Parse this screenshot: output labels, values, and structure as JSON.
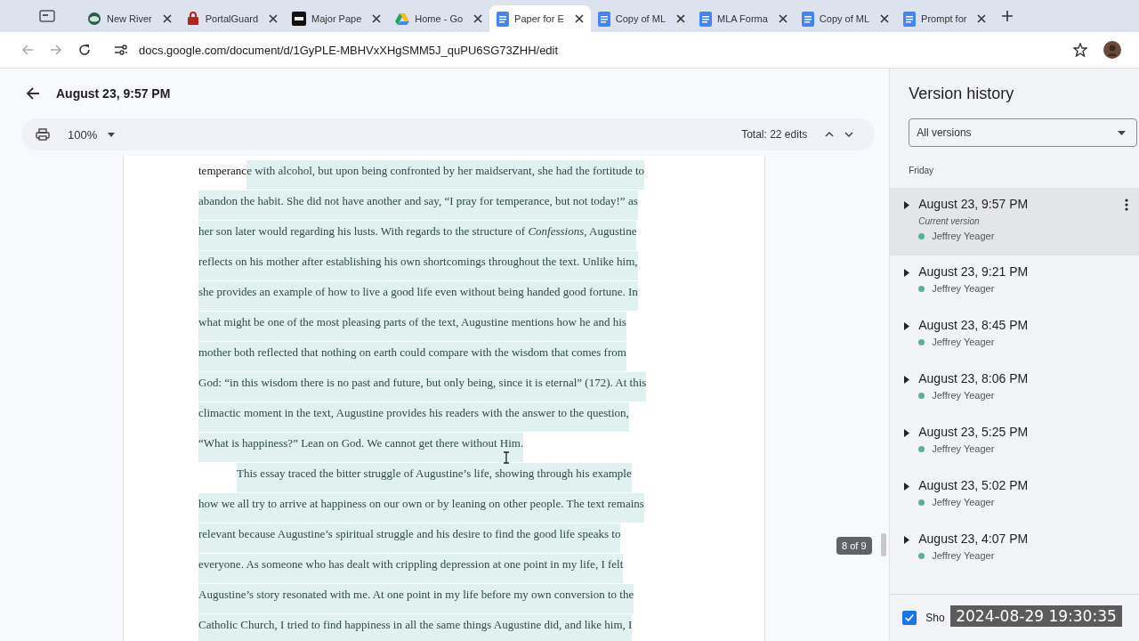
{
  "tabs": [
    {
      "title": "New River",
      "kind": "globe",
      "selected": false
    },
    {
      "title": "PortalGuard",
      "kind": "lock",
      "selected": false
    },
    {
      "title": "Major Pape",
      "kind": "logo",
      "selected": false
    },
    {
      "title": "Home - Go",
      "kind": "drive",
      "selected": false
    },
    {
      "title": "Paper for E",
      "kind": "doc",
      "selected": true
    },
    {
      "title": "Copy of ML",
      "kind": "doc",
      "selected": false
    },
    {
      "title": "MLA Forma",
      "kind": "doc",
      "selected": false
    },
    {
      "title": "Copy of ML",
      "kind": "doc",
      "selected": false
    },
    {
      "title": "Prompt for",
      "kind": "doc",
      "selected": false
    }
  ],
  "address_bar": {
    "url": "docs.google.com/document/d/1GyPLE-MBHVxXHgSMM5J_quPU6SG73ZHH/edit"
  },
  "header": {
    "title": "August 23, 9:57 PM"
  },
  "toolbar": {
    "zoom": "100%",
    "total": "Total: 22 edits"
  },
  "document": {
    "lines": [
      {
        "indent": false,
        "segments": [
          {
            "text": "temperanc",
            "highlighted": false
          },
          {
            "text": "e with alcohol, but upon being confronted by her maidservant, she had the fortitude to",
            "highlighted": true
          }
        ]
      },
      {
        "indent": false,
        "segments": [
          {
            "text": "abandon the habit. She did not have another and say, “I pray for temperance, but not today!” as",
            "highlighted": true
          }
        ]
      },
      {
        "indent": false,
        "segments": [
          {
            "text": "her son later would regarding his lusts. With regards to the structure of *Confessions*, Augustine",
            "highlighted": true
          }
        ]
      },
      {
        "indent": false,
        "segments": [
          {
            "text": "reflects on his mother after establishing his own shortcomings throughout the text. Unlike him,",
            "highlighted": true
          }
        ]
      },
      {
        "indent": false,
        "segments": [
          {
            "text": "she provides an example of how to live a good life even without being handed good fortune. In",
            "highlighted": true
          }
        ]
      },
      {
        "indent": false,
        "segments": [
          {
            "text": "what might be one of the most pleasing parts of the text, Augustine mentions how he and his",
            "highlighted": true
          }
        ]
      },
      {
        "indent": false,
        "segments": [
          {
            "text": "mother both reflected that nothing on earth could compare with the wisdom that comes from",
            "highlighted": true
          }
        ]
      },
      {
        "indent": false,
        "segments": [
          {
            "text": "God: “in this wisdom there is no past and future, but only being, since it is eternal” (172). At this",
            "highlighted": true
          }
        ]
      },
      {
        "indent": false,
        "segments": [
          {
            "text": "climactic moment in the text, Augustine provides his readers with the answer to the question,",
            "highlighted": true
          }
        ]
      },
      {
        "indent": false,
        "segments": [
          {
            "text": "“What is happiness?” Lean on God. We cannot get there without Him.",
            "highlighted": true
          }
        ]
      },
      {
        "indent": true,
        "segments": [
          {
            "text": "This essay traced the bitter struggle of Augustine’s life, showing through his example",
            "highlighted": true
          }
        ]
      },
      {
        "indent": false,
        "segments": [
          {
            "text": "how we all try to arrive at happiness on our own or by leaning on other people. The text remains",
            "highlighted": true
          }
        ]
      },
      {
        "indent": false,
        "segments": [
          {
            "text": "relevant because Augustine’s spiritual struggle and his desire to find the good life speaks to",
            "highlighted": true
          }
        ]
      },
      {
        "indent": false,
        "segments": [
          {
            "text": "everyone. As someone who has dealt with crippling depression at one point in my life, I felt",
            "highlighted": true
          }
        ]
      },
      {
        "indent": false,
        "segments": [
          {
            "text": "Augustine’s story resonated with me. At one point in my life before my own conversion to the",
            "highlighted": true
          }
        ]
      },
      {
        "indent": false,
        "segments": [
          {
            "text": "Catholic Church, I tried to find happiness in all the same things Augustine did, and like him, I",
            "highlighted": true
          }
        ]
      }
    ],
    "page_badge": "8 of 9"
  },
  "version_history": {
    "title": "Version history",
    "filter": "All versions",
    "group": "Friday",
    "versions": [
      {
        "time": "August 23, 9:57 PM",
        "note": "Current version",
        "author": "Jeffrey Yeager",
        "color": "#5bb08f",
        "selected": true
      },
      {
        "time": "August 23, 9:21 PM",
        "author": "Jeffrey Yeager",
        "color": "#5bb08f",
        "selected": false
      },
      {
        "time": "August 23, 8:45 PM",
        "author": "Jeffrey Yeager",
        "color": "#5bb08f",
        "selected": false
      },
      {
        "time": "August 23, 8:06 PM",
        "author": "Jeffrey Yeager",
        "color": "#5bb08f",
        "selected": false
      },
      {
        "time": "August 23, 5:25 PM",
        "author": "Jeffrey Yeager",
        "color": "#5bb08f",
        "selected": false
      },
      {
        "time": "August 23, 5:02 PM",
        "author": "Jeffrey Yeager",
        "color": "#5bb08f",
        "selected": false
      },
      {
        "time": "August 23, 4:07 PM",
        "author": "Jeffrey Yeager",
        "color": "#5bb08f",
        "selected": false
      }
    ],
    "show_changes": {
      "label": "Sho",
      "checked": true
    }
  },
  "timestamp_overlay": "2024-08-29 19:30:35"
}
